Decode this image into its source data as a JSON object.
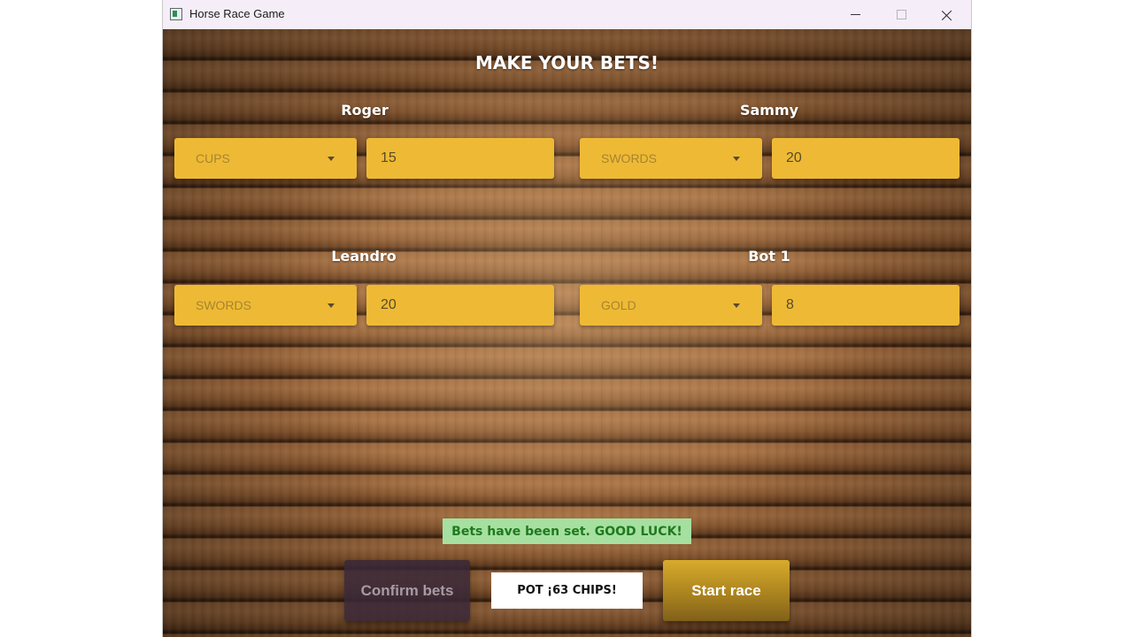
{
  "window": {
    "title": "Horse Race Game",
    "controls": {
      "minimize": "minimize-icon",
      "maximize": "maximize-icon",
      "close": "close-icon"
    }
  },
  "heading": "MAKE YOUR BETS!",
  "players": [
    {
      "name": "Roger",
      "selected_option": "CUPS",
      "bet_amount": "15"
    },
    {
      "name": "Sammy",
      "selected_option": "SWORDS",
      "bet_amount": "20"
    },
    {
      "name": "Leandro",
      "selected_option": "SWORDS",
      "bet_amount": "20"
    },
    {
      "name": "Bot 1",
      "selected_option": "GOLD",
      "bet_amount": "8"
    }
  ],
  "status_message": "Bets have been set. GOOD LUCK!",
  "pot_label": "POT ¡63 CHIPS!",
  "buttons": {
    "confirm_label": "Confirm bets",
    "start_label": "Start race"
  },
  "colors": {
    "field_background": "#eeba35",
    "status_background": "#a6e0a0",
    "status_text": "#1f7a1f",
    "confirm_background": "#3a2838",
    "start_background": "#c99a26"
  }
}
